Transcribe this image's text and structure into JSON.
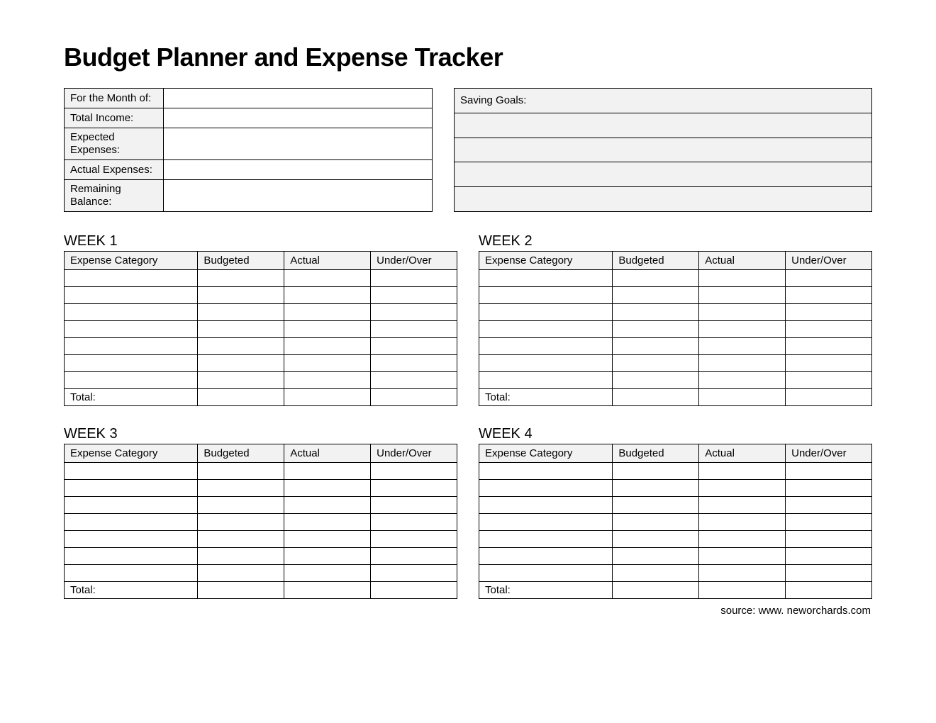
{
  "title": "Budget Planner and Expense Tracker",
  "summary": {
    "rows": [
      {
        "label": "For the Month of:",
        "value": ""
      },
      {
        "label": "Total Income:",
        "value": ""
      },
      {
        "label": "Expected Expenses:",
        "value": ""
      },
      {
        "label": "Actual Expenses:",
        "value": ""
      },
      {
        "label": "Remaining Balance:",
        "value": ""
      }
    ]
  },
  "goals": {
    "header": "Saving Goals:",
    "rows": [
      "",
      "",
      "",
      ""
    ]
  },
  "week_columns": {
    "category": "Expense Category",
    "budgeted": "Budgeted",
    "actual": "Actual",
    "under_over": "Under/Over"
  },
  "total_label": "Total:",
  "weeks": [
    {
      "title": "WEEK 1",
      "rows": [
        {},
        {},
        {},
        {},
        {},
        {},
        {}
      ]
    },
    {
      "title": "WEEK 2",
      "rows": [
        {},
        {},
        {},
        {},
        {},
        {},
        {}
      ]
    },
    {
      "title": "WEEK 3",
      "rows": [
        {},
        {},
        {},
        {},
        {},
        {},
        {}
      ]
    },
    {
      "title": "WEEK 4",
      "rows": [
        {},
        {},
        {},
        {},
        {},
        {},
        {}
      ]
    }
  ],
  "source": "source: www. neworchards.com"
}
